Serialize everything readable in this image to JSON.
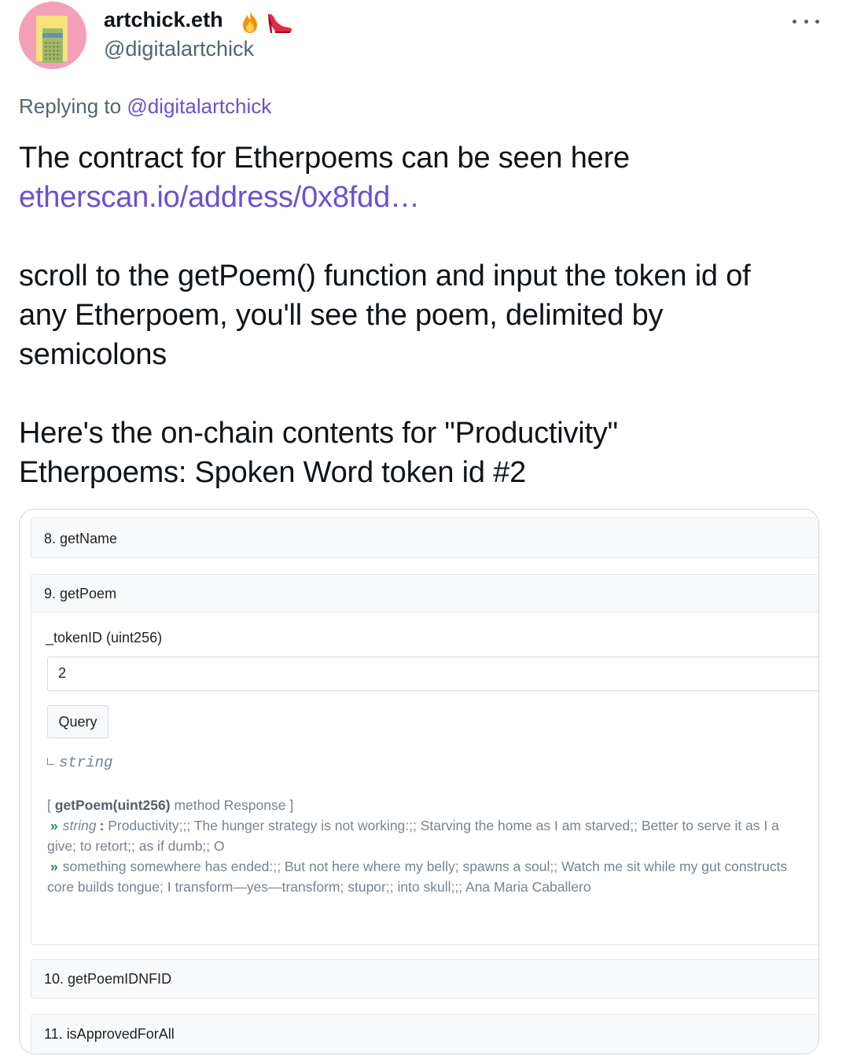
{
  "tweet": {
    "author": {
      "display_name": "artchick.eth",
      "handle": "@digitalartchick",
      "emojis": [
        "fire-emoji",
        "high-heel-emoji"
      ]
    },
    "replying_prefix": "Replying to",
    "replying_to": "@digitalartchick",
    "text": {
      "line1": "The contract for Etherpoems can be seen here",
      "link": "etherscan.io/address/0x8fdd…",
      "para2_lines": [
        "scroll to the getPoem() function and input the token id of",
        "any Etherpoem, you'll see the poem, delimited by",
        "semicolons"
      ],
      "para3_lines": [
        "Here's the on-chain contents for \"Productivity\"",
        "Etherpoems: Spoken Word token id #2"
      ]
    }
  },
  "contract_ui": {
    "functions": [
      {
        "label": "8. getName"
      },
      {
        "label": "9. getPoem"
      },
      {
        "label": "10. getPoemIDNFID"
      },
      {
        "label": "11. isApprovedForAll"
      }
    ],
    "get_poem": {
      "param_label": "_tokenID (uint256)",
      "input_value": "2",
      "query_label": "Query",
      "return_type": "string",
      "response": {
        "open": "[",
        "method": "getPoem(uint256)",
        "suffix": "method Response ]",
        "type_label": "string",
        "colon": ":",
        "line1": "Productivity;;; The hunger strategy is not working:;; Starving the home as I am starved;; Better to serve it as I a",
        "line2": "give; to retort;; as if dumb;; O",
        "line3": "something somewhere has ended:;; But not here where my belly; spawns a soul;; Watch me sit while my gut constructs",
        "line4": "core builds tongue; I transform—yes—transform; stupor;; into skull;;; Ana Maria Caballero"
      }
    }
  },
  "colors": {
    "link": "#6e4fd0",
    "muted": "#536471",
    "chevron": "#2a8a5a"
  }
}
